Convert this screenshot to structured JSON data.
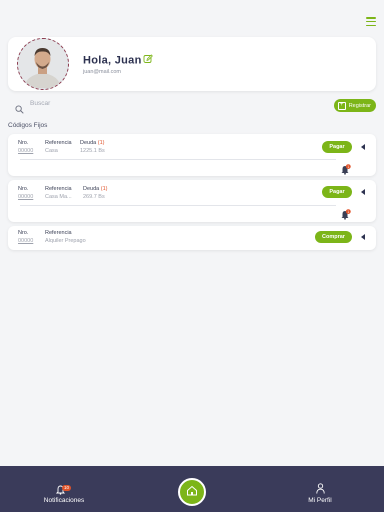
{
  "header": {
    "greeting": "Hola, Juan",
    "email": "juan@mail.com"
  },
  "search": {
    "placeholder": "Buscar",
    "register_label": "Registrar"
  },
  "section_title": "Códigos Fijos",
  "codes": [
    {
      "nro_label": "Nro.",
      "nro": "00000",
      "ref_label": "Referencia",
      "ref": "Casa",
      "debt_label": "Deuda",
      "debt_count": "(1)",
      "debt": "1225.1 Bs",
      "action": "Pagar",
      "bell_count": "1"
    },
    {
      "nro_label": "Nro.",
      "nro": "00000",
      "ref_label": "Referencia",
      "ref": "Casa Ma...",
      "debt_label": "Deuda",
      "debt_count": "(1)",
      "debt": "269.7 Bs",
      "action": "Pagar",
      "bell_count": "1"
    },
    {
      "nro_label": "Nro.",
      "nro": "00000",
      "ref_label": "Referencia",
      "ref": "Alquiler Prepago",
      "action": "Comprar"
    }
  ],
  "nav": {
    "notifications_label": "Notificaciones",
    "notifications_count": "10",
    "profile_label": "Mi Perfil"
  },
  "colors": {
    "accent": "#7cb518",
    "nav_bg": "#3a3b5a",
    "alert": "#e0532a"
  },
  "icons": [
    "menu-icon",
    "edit-icon",
    "search-icon",
    "plus-icon",
    "bell-icon",
    "caret-left-icon",
    "home-icon",
    "user-icon"
  ]
}
